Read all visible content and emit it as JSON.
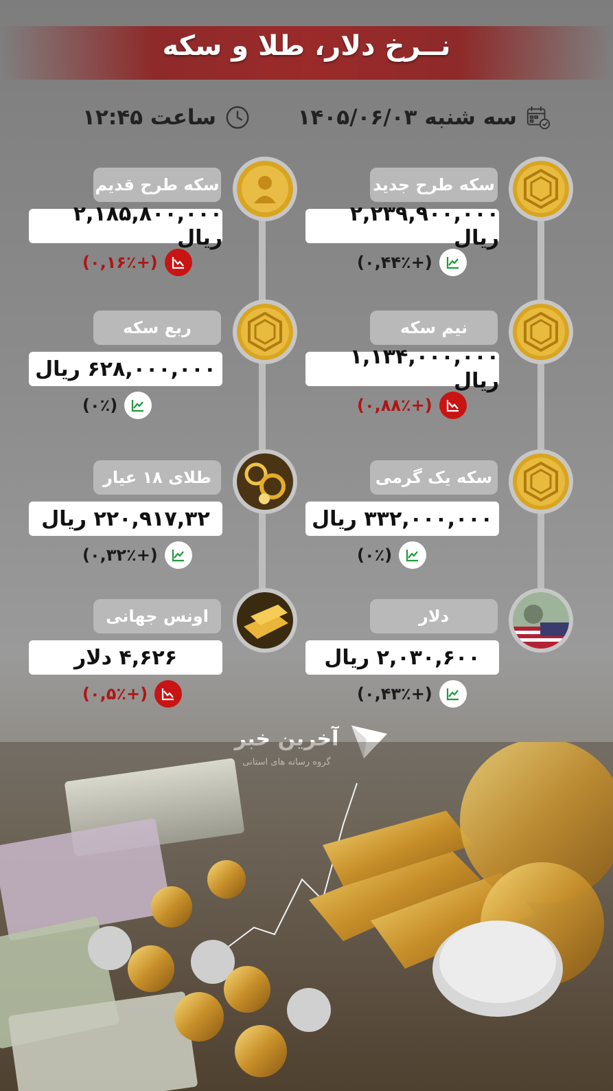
{
  "header": {
    "title": "نــرخ دلار، طلا و سکه"
  },
  "meta": {
    "date": "سه شنبه ۱۴۰۵/۰۶/۰۳",
    "time": "ساعت ۱۲:۴۵"
  },
  "items": [
    {
      "label": "سکه طرح جدید",
      "value": "۲,۲۳۹,۹۰۰,۰۰۰ ریال",
      "change": "(+۰,۴۴٪)",
      "trend": "up",
      "icon": "gold-coin-icon"
    },
    {
      "label": "سکه طرح قدیم",
      "value": "۲,۱۸۵,۸۰۰,۰۰۰ ریال",
      "change": "(+۰,۱۶٪)",
      "trend": "down",
      "icon": "old-gold-coin-icon"
    },
    {
      "label": "نیم سکه",
      "value": "۱,۱۳۴,۰۰۰,۰۰۰ ریال",
      "change": "(+۰,۸۸٪)",
      "trend": "down",
      "icon": "gold-coin-icon"
    },
    {
      "label": "ربع سکه",
      "value": "۶۲۸,۰۰۰,۰۰۰ ریال",
      "change": "(۰٪)",
      "trend": "up",
      "icon": "gold-coin-icon"
    },
    {
      "label": "سکه یک گرمی",
      "value": "۳۳۲,۰۰۰,۰۰۰ ریال",
      "change": "(۰٪)",
      "trend": "up",
      "icon": "gold-coin-icon"
    },
    {
      "label": "طلای ۱۸ عیار",
      "value": "۲۲۰,۹۱۷,۳۲ ریال",
      "change": "(+۰,۳۲٪)",
      "trend": "up",
      "icon": "gold-jewelry-icon"
    },
    {
      "label": "دلار",
      "value": "۲,۰۳۰,۶۰۰ ریال",
      "change": "(+۰,۴۳٪)",
      "trend": "up",
      "icon": "dollar-bill-icon"
    },
    {
      "label": "اونس جهانی",
      "value": "۴,۶۲۶ دلار",
      "change": "(+۰,۵٪)",
      "trend": "down",
      "icon": "gold-bar-icon"
    }
  ],
  "brand": {
    "name": "آخرین خبر",
    "subtitle": "گروه رسانه های استانی"
  },
  "colors": {
    "header_red": "#9b2a2a",
    "down_red": "#c91414",
    "up_green": "#1e9a3c",
    "coin_gold": "#d9a520"
  }
}
